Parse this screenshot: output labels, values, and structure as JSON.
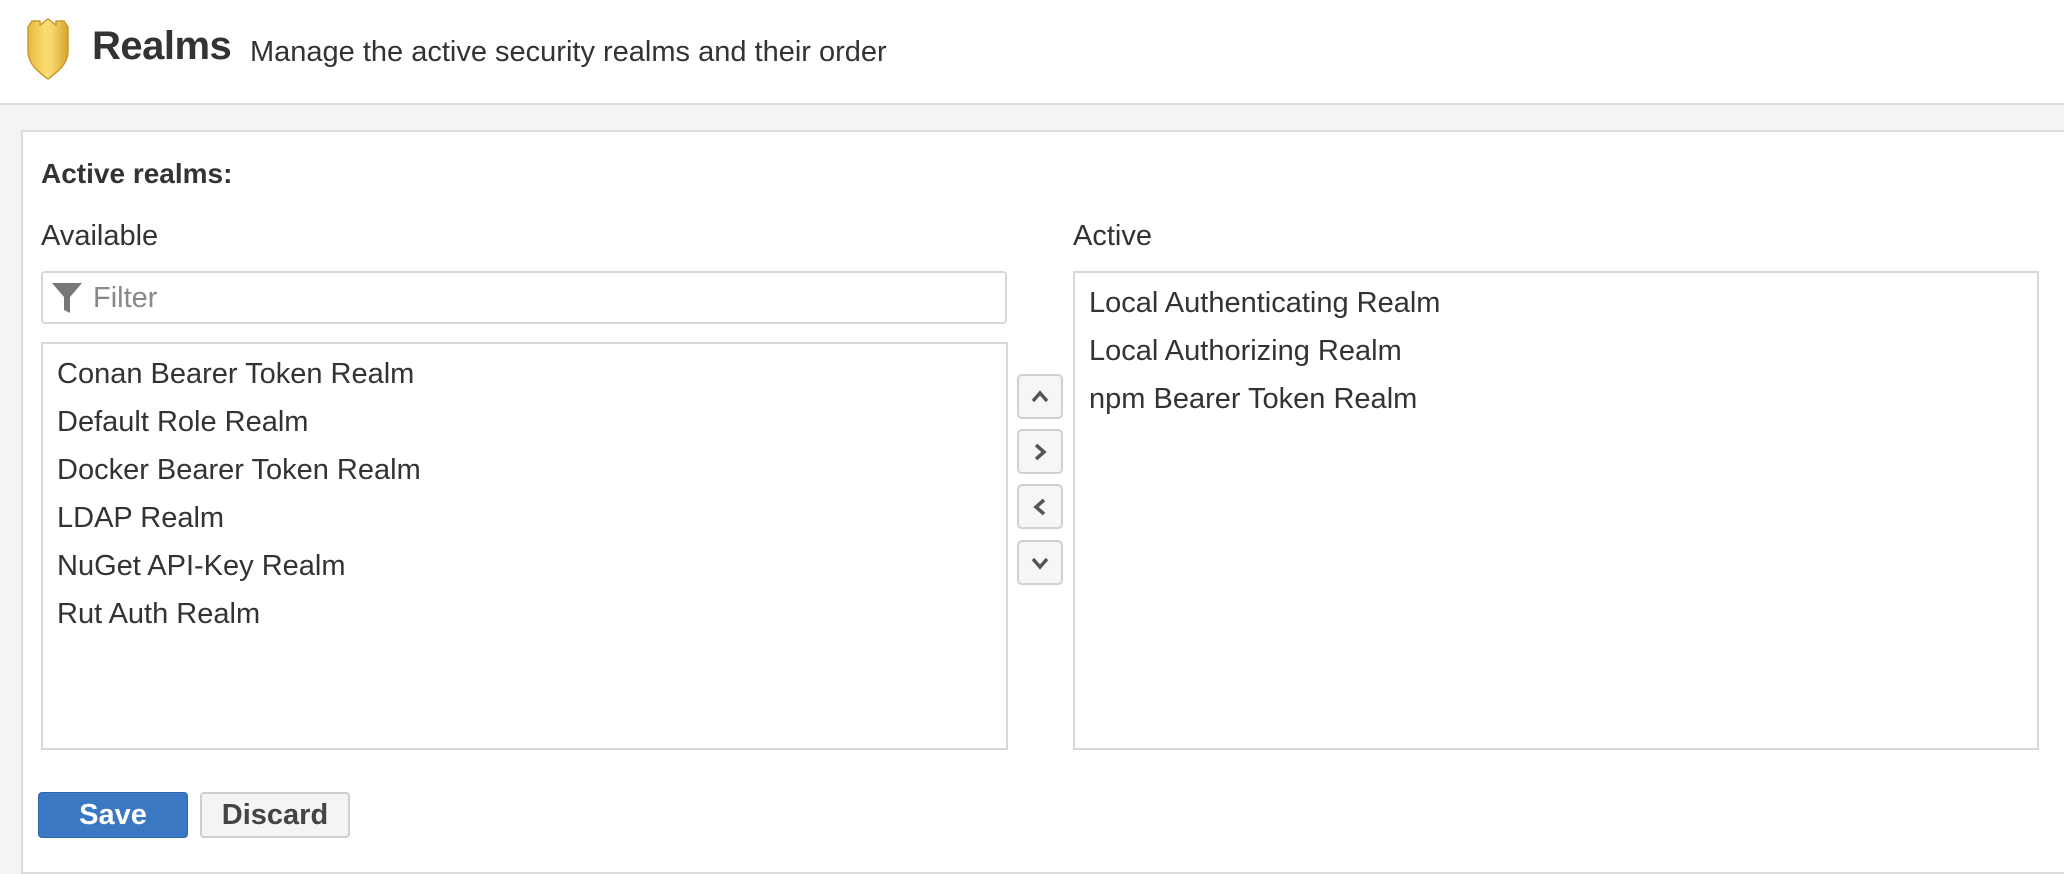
{
  "header": {
    "icon": "shield-icon",
    "title": "Realms",
    "subtitle": "Manage the active security realms and their order"
  },
  "section_title": "Active realms:",
  "available": {
    "label": "Available",
    "filter_placeholder": "Filter",
    "filter_value": "",
    "items": [
      "Conan Bearer Token Realm",
      "Default Role Realm",
      "Docker Bearer Token Realm",
      "LDAP Realm",
      "NuGet API-Key Realm",
      "Rut Auth Realm"
    ]
  },
  "active": {
    "label": "Active",
    "items": [
      "Local Authenticating Realm",
      "Local Authorizing Realm",
      "npm Bearer Token Realm"
    ]
  },
  "move_buttons": [
    "chevron-up-icon",
    "chevron-right-icon",
    "chevron-left-icon",
    "chevron-down-icon"
  ],
  "actions": {
    "save": "Save",
    "discard": "Discard"
  },
  "colors": {
    "primary": "#3a78c3",
    "shield": "#f2c94c"
  }
}
